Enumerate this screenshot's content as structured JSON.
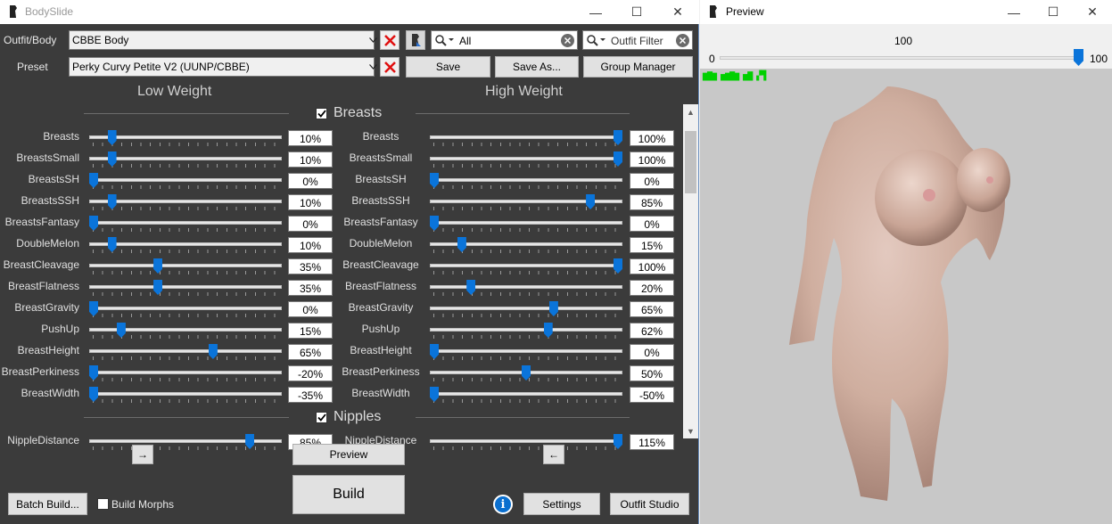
{
  "bodyslide": {
    "title": "BodySlide",
    "outfit_label": "Outfit/Body",
    "outfit_value": "CBBE Body",
    "preset_label": "Preset",
    "preset_value": "Perky Curvy Petite V2 (UUNP/CBBE)",
    "group_filter_value": "All",
    "outfit_filter_placeholder": "Outfit Filter",
    "save_label": "Save",
    "save_as_label": "Save As...",
    "group_manager_label": "Group Manager",
    "low_weight_label": "Low Weight",
    "high_weight_label": "High Weight",
    "copy_right_arrow": "→",
    "copy_left_arrow": "←",
    "preview_label": "Preview",
    "build_label": "Build",
    "batch_build_label": "Batch Build...",
    "build_morphs_label": "Build Morphs",
    "settings_label": "Settings",
    "outfit_studio_label": "Outfit Studio",
    "info_glyph": "i",
    "accent_color": "#0a74da",
    "categories": [
      {
        "name": "Breasts",
        "checked": true,
        "sliders": [
          {
            "name": "Breasts",
            "low": "10%",
            "high": "100%",
            "low_pos": 0.1,
            "high_pos": 1.0
          },
          {
            "name": "BreastsSmall",
            "low": "10%",
            "high": "100%",
            "low_pos": 0.1,
            "high_pos": 1.0
          },
          {
            "name": "BreastsSH",
            "low": "0%",
            "high": "0%",
            "low_pos": 0.0,
            "high_pos": 0.0
          },
          {
            "name": "BreastsSSH",
            "low": "10%",
            "high": "85%",
            "low_pos": 0.1,
            "high_pos": 0.85
          },
          {
            "name": "BreastsFantasy",
            "low": "0%",
            "high": "0%",
            "low_pos": 0.0,
            "high_pos": 0.0
          },
          {
            "name": "DoubleMelon",
            "low": "10%",
            "high": "15%",
            "low_pos": 0.1,
            "high_pos": 0.15
          },
          {
            "name": "BreastCleavage",
            "low": "35%",
            "high": "100%",
            "low_pos": 0.35,
            "high_pos": 1.0
          },
          {
            "name": "BreastFlatness",
            "low": "35%",
            "high": "20%",
            "low_pos": 0.35,
            "high_pos": 0.2
          },
          {
            "name": "BreastGravity",
            "low": "0%",
            "high": "65%",
            "low_pos": 0.0,
            "high_pos": 0.65
          },
          {
            "name": "PushUp",
            "low": "15%",
            "high": "62%",
            "low_pos": 0.15,
            "high_pos": 0.62
          },
          {
            "name": "BreastHeight",
            "low": "65%",
            "high": "0%",
            "low_pos": 0.65,
            "high_pos": 0.0
          },
          {
            "name": "BreastPerkiness",
            "low": "-20%",
            "high": "50%",
            "low_pos": 0.0,
            "high_pos": 0.5
          },
          {
            "name": "BreastWidth",
            "low": "-35%",
            "high": "-50%",
            "low_pos": 0.0,
            "high_pos": 0.0
          }
        ]
      },
      {
        "name": "Nipples",
        "checked": true,
        "sliders": [
          {
            "name": "NippleDistance",
            "low": "85%",
            "high": "115%",
            "low_pos": 0.85,
            "high_pos": 1.0
          }
        ]
      }
    ]
  },
  "preview": {
    "title": "Preview",
    "weight_value": "100",
    "min_label": "0",
    "max_label": "100",
    "weight_fraction": 1.0,
    "overlay_text": "▆▇▆ ▅▆▇▆ ▅▇  ▞▜"
  }
}
